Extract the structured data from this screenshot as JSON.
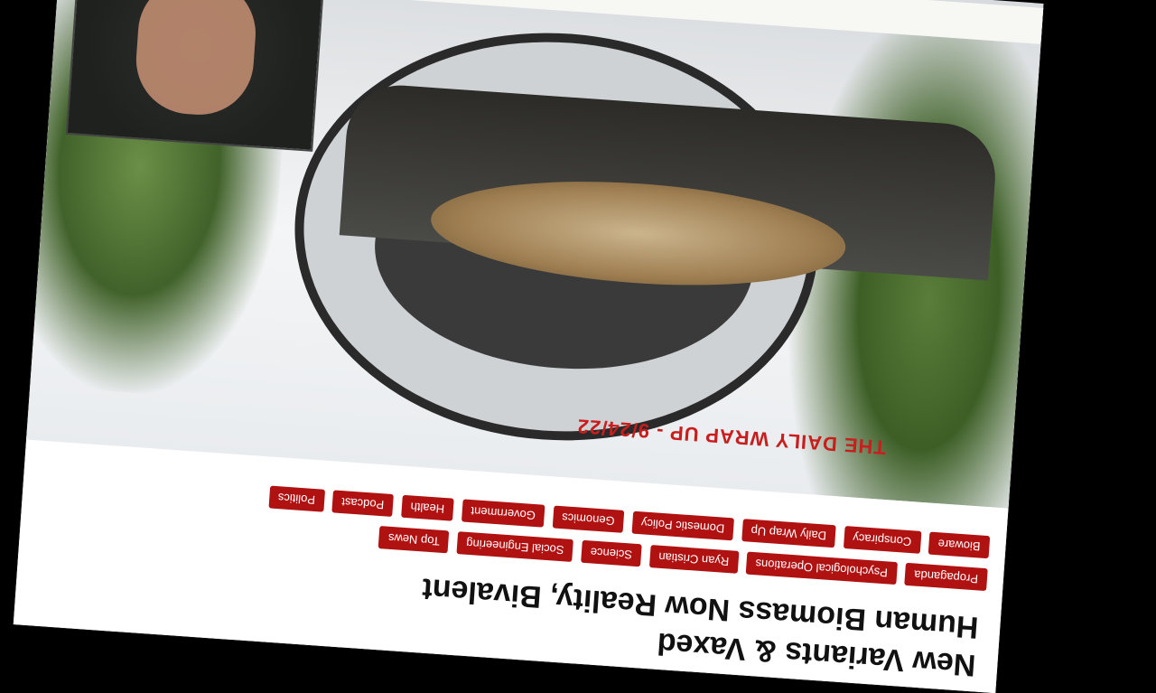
{
  "article": {
    "title_line1": "Human Biomass Now Reality, Bivalent",
    "title_line2": "New Variants & Vaxed"
  },
  "tags_row1": [
    "Bioware",
    "Conspiracy",
    "Daily Wrap Up",
    "Domestic Policy",
    "Genomics",
    "Government",
    "Health",
    "Podcast",
    "Politics"
  ],
  "tags_row2": [
    "Propaganda",
    "Psychological Operations",
    "Ryan Cristian",
    "Science",
    "Social Engineering",
    "Top News"
  ],
  "hero": {
    "caption": "THE DAILY WRAP UP - 9/24/22"
  },
  "colors": {
    "tag_bg": "#b01212",
    "caption": "#c81e1e"
  }
}
